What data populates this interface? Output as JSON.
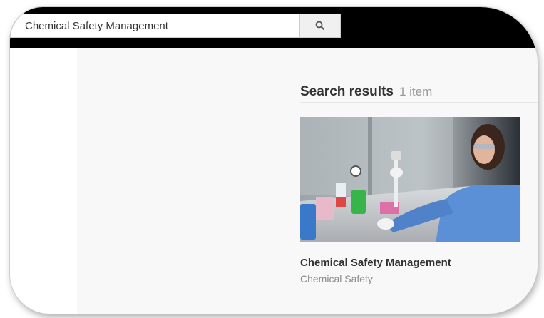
{
  "search": {
    "value": "Chemical Safety Management",
    "button_icon": "search-icon"
  },
  "results": {
    "title": "Search results",
    "count": "1 item",
    "items": [
      {
        "title": "Chemical Safety Management",
        "subtitle": "Chemical Safety",
        "thumbnail_icon": "lab-photo"
      }
    ]
  },
  "colors": {
    "topbar": "#000000",
    "content_bg": "#f8f8f8",
    "title_text": "#333333",
    "muted_text": "#9a9a9a",
    "lab_coat": "#5b8fd6"
  }
}
